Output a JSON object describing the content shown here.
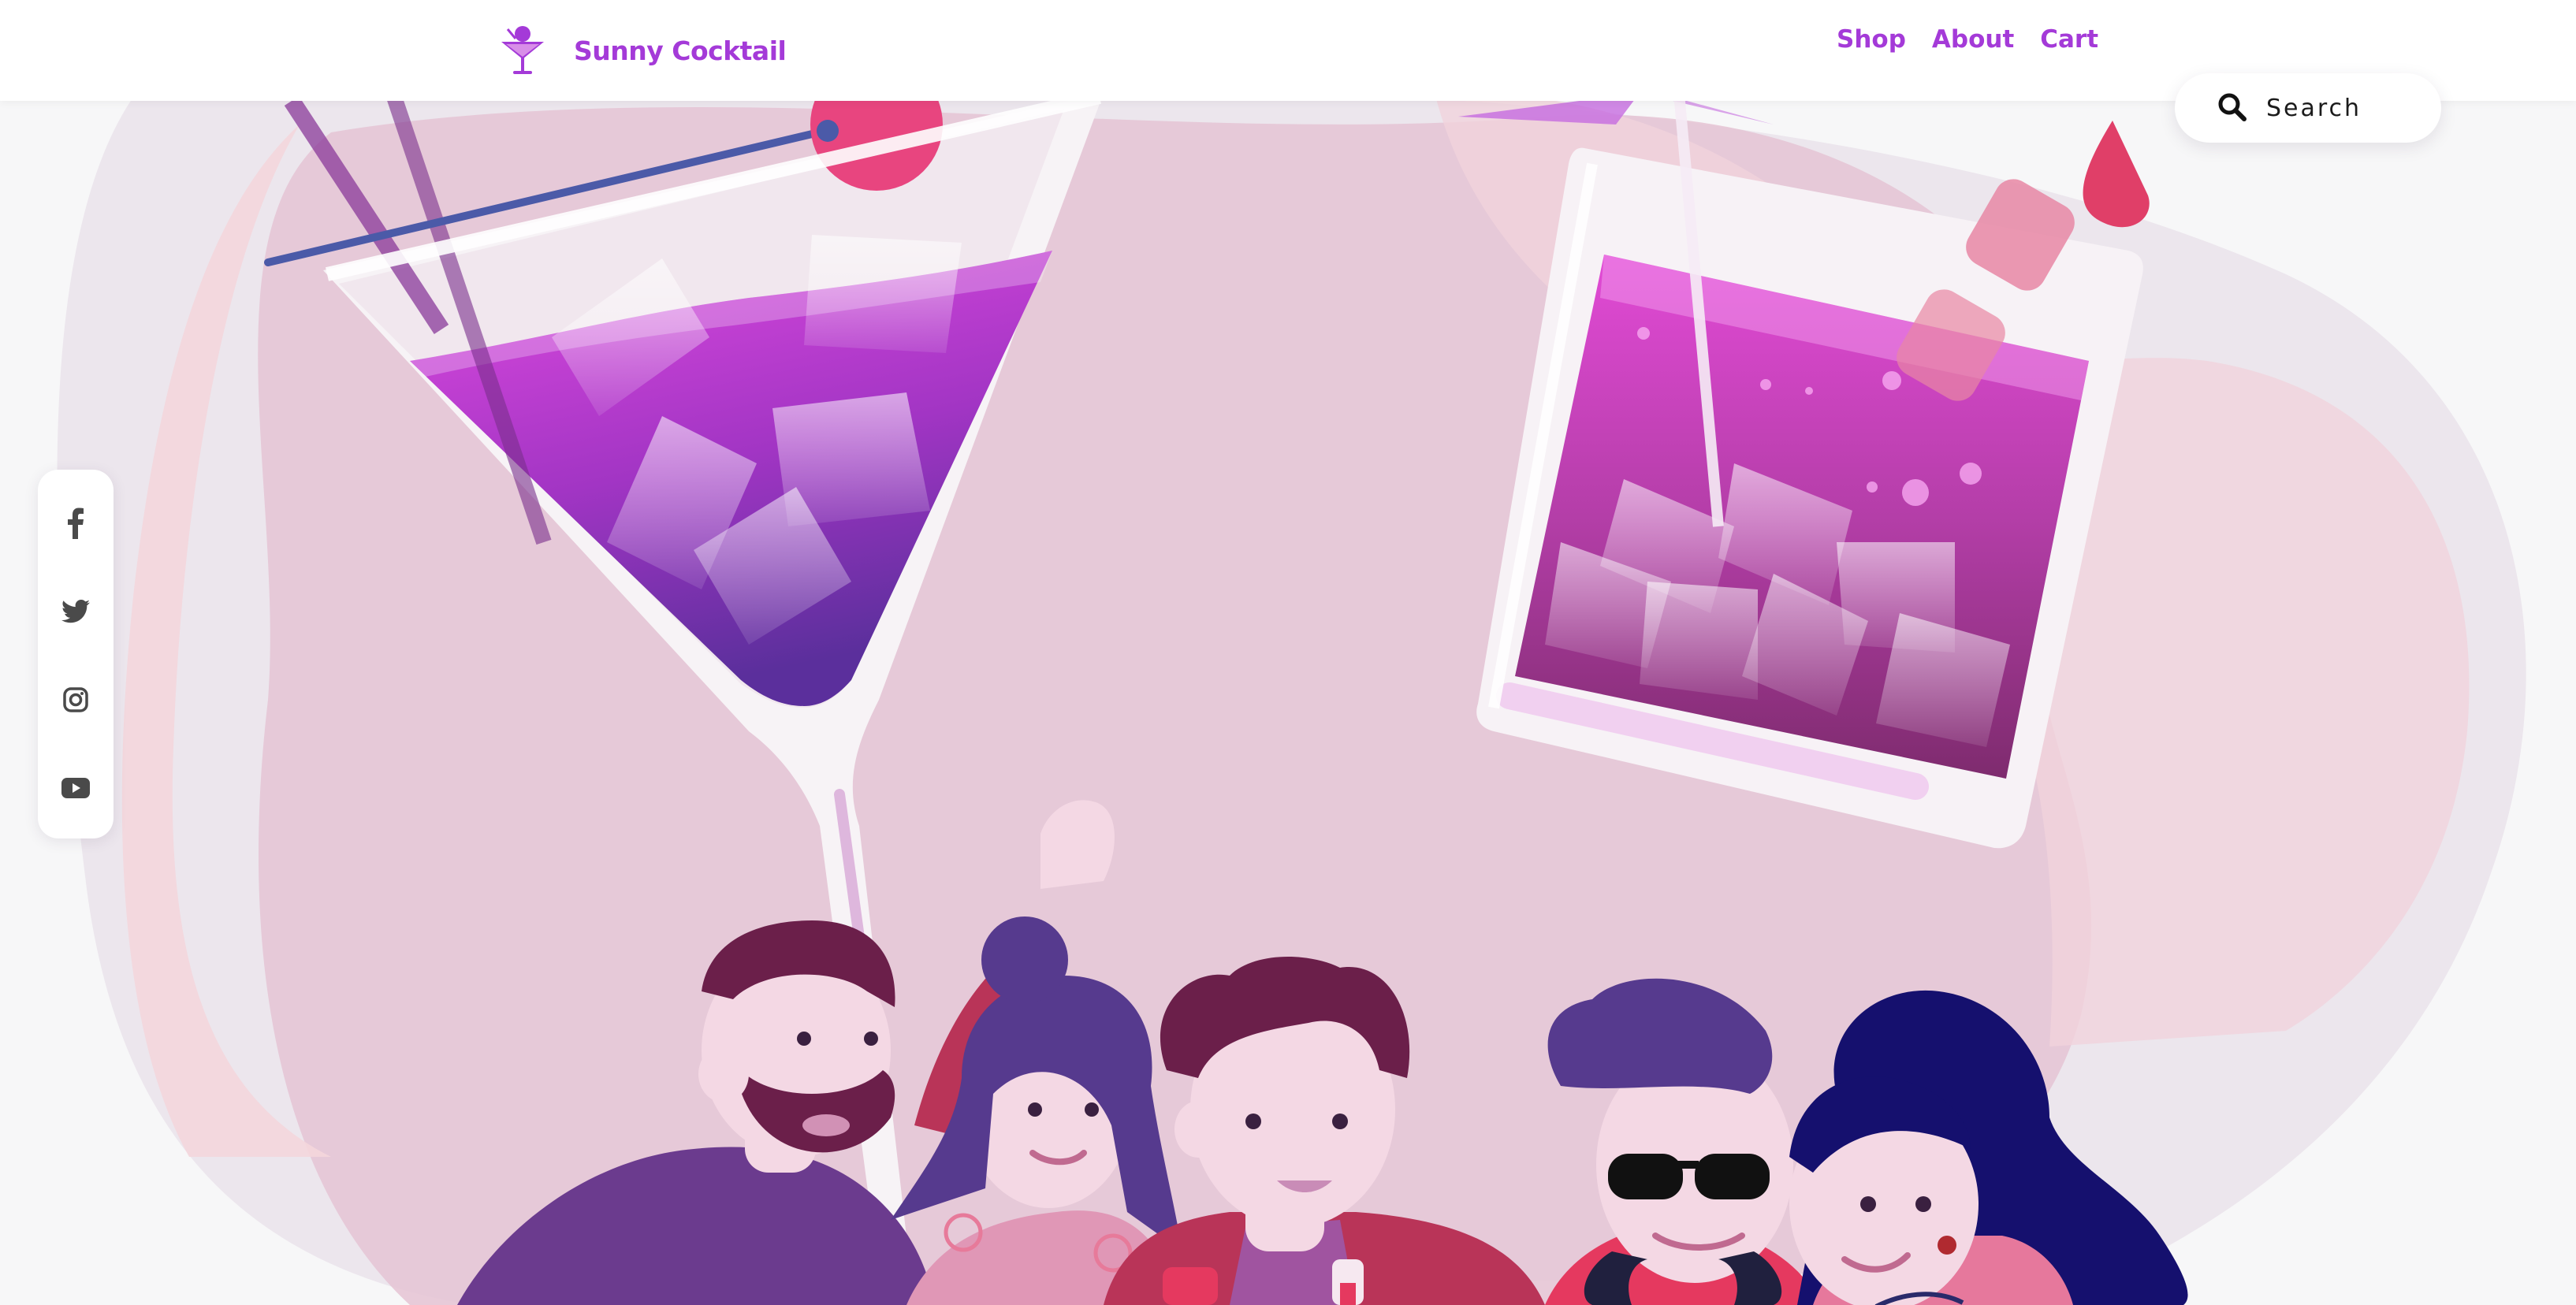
{
  "brand": {
    "name": "Sunny Cocktail",
    "logo_icon": "cocktail-glass-icon",
    "color": "#a43ad8"
  },
  "nav": {
    "shop": "Shop",
    "about": "About",
    "cart": "Cart"
  },
  "search": {
    "placeholder": "Search",
    "icon": "search-icon"
  },
  "social": {
    "items": [
      "facebook-icon",
      "twitter-icon",
      "instagram-icon",
      "youtube-icon"
    ]
  },
  "hero": {
    "illustration": "friends-toasting-cocktails"
  },
  "colors": {
    "accent": "#a43ad8",
    "drink_magenta": "#d23ad4",
    "drink_purple": "#7a3aa8",
    "blob_pink": "#e3c4d2",
    "background": "#f7f7f8"
  }
}
